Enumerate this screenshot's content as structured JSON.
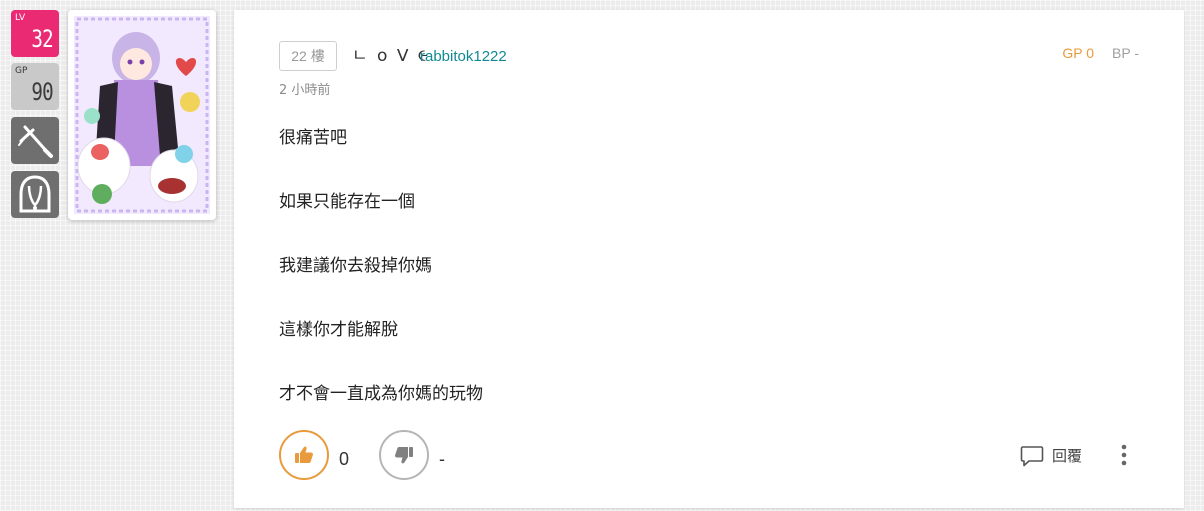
{
  "badges": {
    "level": {
      "prefix": "LV",
      "value": "32"
    },
    "gp": {
      "prefix": "GP",
      "value": "90"
    },
    "job_icon": "sword-icon",
    "race_icon": "ghost-icon"
  },
  "avatar": {
    "description_icon": "avatar-image"
  },
  "post": {
    "floor": "22 樓",
    "nickname": "ㄴ o ᐯ ૯",
    "user_id": "rabbitok1222",
    "time": "2 小時前",
    "gp_label": "GP 0",
    "bp_label": "BP -",
    "lines": [
      "很痛苦吧",
      "如果只能存在一個",
      "我建議你去殺掉你媽",
      "這樣你才能解脫",
      "才不會一直成為你媽的玩物"
    ]
  },
  "actions": {
    "like_count": "0",
    "dislike_count": "-",
    "reply_label": "回覆",
    "icons": {
      "like": "thumbs-up-icon",
      "dislike": "thumbs-down-icon",
      "reply": "comment-icon",
      "more": "more-vertical-icon"
    }
  },
  "colors": {
    "level_badge": "#ea2b74",
    "gp_badge": "#c9c9c9",
    "icon_badge": "#6f6f6f",
    "gp_text": "#e89a3c",
    "user_id": "#118a94",
    "like_border": "#e89a3c",
    "dislike_border": "#b5b5b5"
  }
}
